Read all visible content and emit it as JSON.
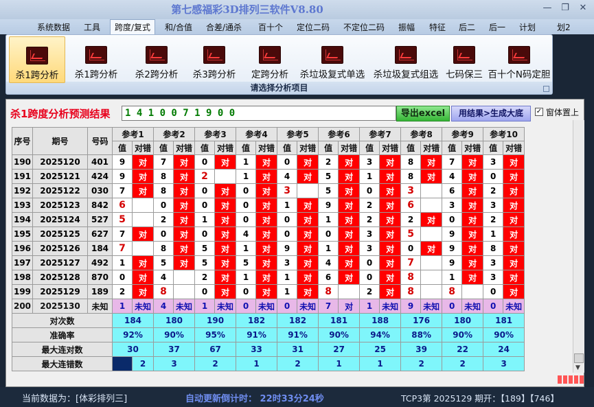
{
  "window": {
    "title": "第七感福彩3D排列三软件V8.80"
  },
  "menu": [
    "系统数据",
    "工具",
    "跨度/复式",
    "和/合值",
    "合差/通杀",
    "百十个",
    "定位二码",
    "不定位二码",
    "振幅",
    "特征",
    "后二",
    "后一",
    "计划",
    "划2"
  ],
  "menu_active": 2,
  "ribbon": {
    "buttons": [
      "杀1跨分析",
      "杀1跨分析",
      "杀2跨分析",
      "杀3跨分析",
      "定跨分析",
      "杀垃圾复式单选",
      "杀垃圾复式组选",
      "七码保三",
      "百十个N码定胆"
    ],
    "active": 0,
    "footer": "请选择分析项目"
  },
  "prediction": {
    "label": "杀1跨度分析预测结果",
    "value": "1 4 1 0 0 7 1 9 0 0",
    "export_button": "导出excel",
    "generate_button": "用结果>生成大底",
    "topmost_label": "窗体置上",
    "topmost_checked": "✓"
  },
  "table": {
    "headers": {
      "seq": "序号",
      "period": "期号",
      "code": "号码",
      "val": "值",
      "ok": "对错"
    },
    "refs": [
      "参考1",
      "参考2",
      "参考3",
      "参考4",
      "参考5",
      "参考6",
      "参考7",
      "参考8",
      "参考9",
      "参考10"
    ],
    "rows": [
      {
        "seq": "190",
        "period": "2025120",
        "code": "401",
        "cells": [
          [
            "9",
            "对",
            0,
            1
          ],
          [
            "7",
            "对",
            0,
            1
          ],
          [
            "0",
            "对",
            0,
            1
          ],
          [
            "1",
            "对",
            0,
            1
          ],
          [
            "0",
            "对",
            0,
            1
          ],
          [
            "2",
            "对",
            0,
            1
          ],
          [
            "3",
            "对",
            0,
            1
          ],
          [
            "8",
            "对",
            0,
            1
          ],
          [
            "7",
            "对",
            0,
            1
          ],
          [
            "3",
            "对",
            0,
            1
          ]
        ]
      },
      {
        "seq": "191",
        "period": "2025121",
        "code": "424",
        "cells": [
          [
            "9",
            "对",
            0,
            1
          ],
          [
            "8",
            "对",
            0,
            1
          ],
          [
            "2",
            "",
            1,
            0
          ],
          [
            "1",
            "对",
            0,
            1
          ],
          [
            "4",
            "对",
            0,
            1
          ],
          [
            "5",
            "对",
            0,
            1
          ],
          [
            "1",
            "对",
            0,
            1
          ],
          [
            "8",
            "对",
            0,
            1
          ],
          [
            "4",
            "对",
            0,
            1
          ],
          [
            "0",
            "对",
            0,
            1
          ]
        ]
      },
      {
        "seq": "192",
        "period": "2025122",
        "code": "030",
        "cells": [
          [
            "7",
            "对",
            0,
            1
          ],
          [
            "8",
            "对",
            0,
            1
          ],
          [
            "0",
            "对",
            0,
            1
          ],
          [
            "0",
            "对",
            0,
            1
          ],
          [
            "3",
            "",
            1,
            0
          ],
          [
            "5",
            "对",
            0,
            1
          ],
          [
            "0",
            "对",
            0,
            1
          ],
          [
            "3",
            "",
            1,
            0
          ],
          [
            "6",
            "对",
            0,
            1
          ],
          [
            "2",
            "对",
            0,
            1
          ]
        ]
      },
      {
        "seq": "193",
        "period": "2025123",
        "code": "842",
        "cells": [
          [
            "6",
            "",
            1,
            0
          ],
          [
            "0",
            "对",
            0,
            1
          ],
          [
            "0",
            "对",
            0,
            1
          ],
          [
            "0",
            "对",
            0,
            1
          ],
          [
            "1",
            "对",
            0,
            1
          ],
          [
            "9",
            "对",
            0,
            1
          ],
          [
            "2",
            "对",
            0,
            1
          ],
          [
            "6",
            "",
            1,
            0
          ],
          [
            "3",
            "对",
            0,
            1
          ],
          [
            "3",
            "对",
            0,
            1
          ]
        ]
      },
      {
        "seq": "194",
        "period": "2025124",
        "code": "527",
        "cells": [
          [
            "5",
            "",
            1,
            0
          ],
          [
            "2",
            "对",
            0,
            1
          ],
          [
            "1",
            "对",
            0,
            1
          ],
          [
            "0",
            "对",
            0,
            1
          ],
          [
            "0",
            "对",
            0,
            1
          ],
          [
            "1",
            "对",
            0,
            1
          ],
          [
            "2",
            "对",
            0,
            1
          ],
          [
            "2",
            "对",
            0,
            1
          ],
          [
            "0",
            "对",
            0,
            1
          ],
          [
            "2",
            "对",
            0,
            1
          ]
        ]
      },
      {
        "seq": "195",
        "period": "2025125",
        "code": "627",
        "cells": [
          [
            "7",
            "对",
            0,
            1
          ],
          [
            "0",
            "对",
            0,
            1
          ],
          [
            "0",
            "对",
            0,
            1
          ],
          [
            "4",
            "对",
            0,
            1
          ],
          [
            "0",
            "对",
            0,
            1
          ],
          [
            "0",
            "对",
            0,
            1
          ],
          [
            "3",
            "对",
            0,
            1
          ],
          [
            "5",
            "",
            1,
            0
          ],
          [
            "9",
            "对",
            0,
            1
          ],
          [
            "1",
            "对",
            0,
            1
          ]
        ]
      },
      {
        "seq": "196",
        "period": "2025126",
        "code": "184",
        "cells": [
          [
            "7",
            "",
            1,
            0
          ],
          [
            "8",
            "对",
            0,
            1
          ],
          [
            "5",
            "对",
            0,
            1
          ],
          [
            "1",
            "对",
            0,
            1
          ],
          [
            "9",
            "对",
            0,
            1
          ],
          [
            "1",
            "对",
            0,
            1
          ],
          [
            "3",
            "对",
            0,
            1
          ],
          [
            "0",
            "对",
            0,
            1
          ],
          [
            "9",
            "对",
            0,
            1
          ],
          [
            "8",
            "对",
            0,
            1
          ]
        ]
      },
      {
        "seq": "197",
        "period": "2025127",
        "code": "492",
        "cells": [
          [
            "1",
            "对",
            0,
            1
          ],
          [
            "5",
            "对",
            0,
            1
          ],
          [
            "5",
            "对",
            0,
            1
          ],
          [
            "5",
            "对",
            0,
            1
          ],
          [
            "3",
            "对",
            0,
            1
          ],
          [
            "4",
            "对",
            0,
            1
          ],
          [
            "0",
            "对",
            0,
            1
          ],
          [
            "7",
            "",
            1,
            0
          ],
          [
            "9",
            "对",
            0,
            1
          ],
          [
            "3",
            "对",
            0,
            1
          ]
        ]
      },
      {
        "seq": "198",
        "period": "2025128",
        "code": "870",
        "cells": [
          [
            "0",
            "对",
            0,
            1
          ],
          [
            "4",
            "",
            0,
            0
          ],
          [
            "2",
            "对",
            0,
            1
          ],
          [
            "1",
            "对",
            0,
            1
          ],
          [
            "1",
            "对",
            0,
            1
          ],
          [
            "6",
            "对",
            0,
            1
          ],
          [
            "0",
            "对",
            0,
            1
          ],
          [
            "8",
            "",
            1,
            0
          ],
          [
            "1",
            "对",
            0,
            1
          ],
          [
            "3",
            "对",
            0,
            1
          ]
        ]
      },
      {
        "seq": "199",
        "period": "2025129",
        "code": "189",
        "cells": [
          [
            "2",
            "对",
            0,
            1
          ],
          [
            "8",
            "",
            1,
            0
          ],
          [
            "0",
            "对",
            0,
            1
          ],
          [
            "0",
            "对",
            0,
            1
          ],
          [
            "1",
            "对",
            0,
            1
          ],
          [
            "8",
            "",
            1,
            0
          ],
          [
            "2",
            "对",
            0,
            1
          ],
          [
            "8",
            "",
            1,
            0
          ],
          [
            "8",
            "",
            1,
            0
          ],
          [
            "0",
            "对",
            0,
            1
          ]
        ]
      }
    ],
    "pred_row": {
      "seq": "200",
      "period": "2025130",
      "code": "未知",
      "cells": [
        [
          "1",
          "未知"
        ],
        [
          "4",
          "未知"
        ],
        [
          "1",
          "未知"
        ],
        [
          "0",
          "未知"
        ],
        [
          "0",
          "未知"
        ],
        [
          "7",
          "对"
        ],
        [
          "1",
          "未知"
        ],
        [
          "9",
          "未知"
        ],
        [
          "0",
          "未知"
        ],
        [
          "0",
          "未知"
        ]
      ]
    },
    "stats": [
      {
        "label": "对次数",
        "values": [
          "184",
          "180",
          "190",
          "182",
          "182",
          "181",
          "188",
          "176",
          "180",
          "181"
        ]
      },
      {
        "label": "准确率",
        "values": [
          "92%",
          "90%",
          "95%",
          "91%",
          "91%",
          "90%",
          "94%",
          "88%",
          "90%",
          "90%"
        ]
      },
      {
        "label": "最大连对数",
        "values": [
          "30",
          "37",
          "67",
          "33",
          "31",
          "27",
          "25",
          "39",
          "22",
          "24"
        ]
      },
      {
        "label": "最大连错数",
        "values": [
          "2",
          "3",
          "2",
          "1",
          "2",
          "1",
          "1",
          "2",
          "2",
          "3"
        ]
      }
    ]
  },
  "status": {
    "current_data": "当前数据为：[体彩排列三]",
    "countdown": "自动更新倒计时：  22时33分24秒",
    "tcp": "TCP3第  2025129  期开：【189】【746】"
  }
}
